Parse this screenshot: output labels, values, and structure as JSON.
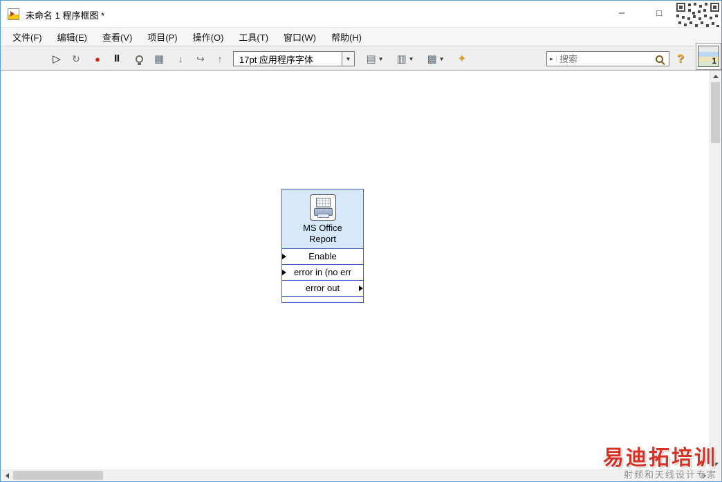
{
  "window": {
    "title": "未命名 1 程序框图 *",
    "minimize_label": "–",
    "maximize_label": "□",
    "close_label": "×"
  },
  "menu": {
    "items": [
      {
        "label": "文件(F)"
      },
      {
        "label": "编辑(E)"
      },
      {
        "label": "查看(V)"
      },
      {
        "label": "项目(P)"
      },
      {
        "label": "操作(O)"
      },
      {
        "label": "工具(T)"
      },
      {
        "label": "窗口(W)"
      },
      {
        "label": "帮助(H)"
      }
    ]
  },
  "toolbar": {
    "caret": "▼",
    "font_label": "17pt 应用程序字体",
    "buttons": [
      {
        "name": "run",
        "glyph": "▷"
      },
      {
        "name": "run-continuously",
        "glyph": "↻"
      },
      {
        "name": "abort",
        "glyph": "●"
      },
      {
        "name": "pause",
        "glyph": "Ⅱ"
      },
      {
        "name": "highlight-execution",
        "glyph": ""
      },
      {
        "name": "retain-wire-values",
        "glyph": "▦"
      },
      {
        "name": "step-into",
        "glyph": "↓"
      },
      {
        "name": "step-over",
        "glyph": "↪"
      },
      {
        "name": "step-out",
        "glyph": "↑"
      },
      {
        "name": "align-objects",
        "glyph": "▤"
      },
      {
        "name": "distribute-objects",
        "glyph": "▥"
      },
      {
        "name": "reorder",
        "glyph": "▩"
      },
      {
        "name": "cleanup-diagram",
        "glyph": "✦"
      }
    ],
    "search": {
      "placeholder": "搜索",
      "scope_glyph": "▸"
    },
    "help_label": "?",
    "vi_icon_number": "1"
  },
  "canvas": {
    "express_vi": {
      "title_line1": "MS Office",
      "title_line2": "Report",
      "rows": [
        {
          "label": "Enable",
          "direction": "input"
        },
        {
          "label": "error in (no err",
          "direction": "input"
        },
        {
          "label": "error out",
          "direction": "output"
        }
      ],
      "border_color": "#3b63c0",
      "fill_color": "#d7e8fa"
    }
  },
  "watermark": {
    "title": "易迪拓培训",
    "subtitle": "射频和天线设计专家",
    "title_color": "#d93025"
  }
}
